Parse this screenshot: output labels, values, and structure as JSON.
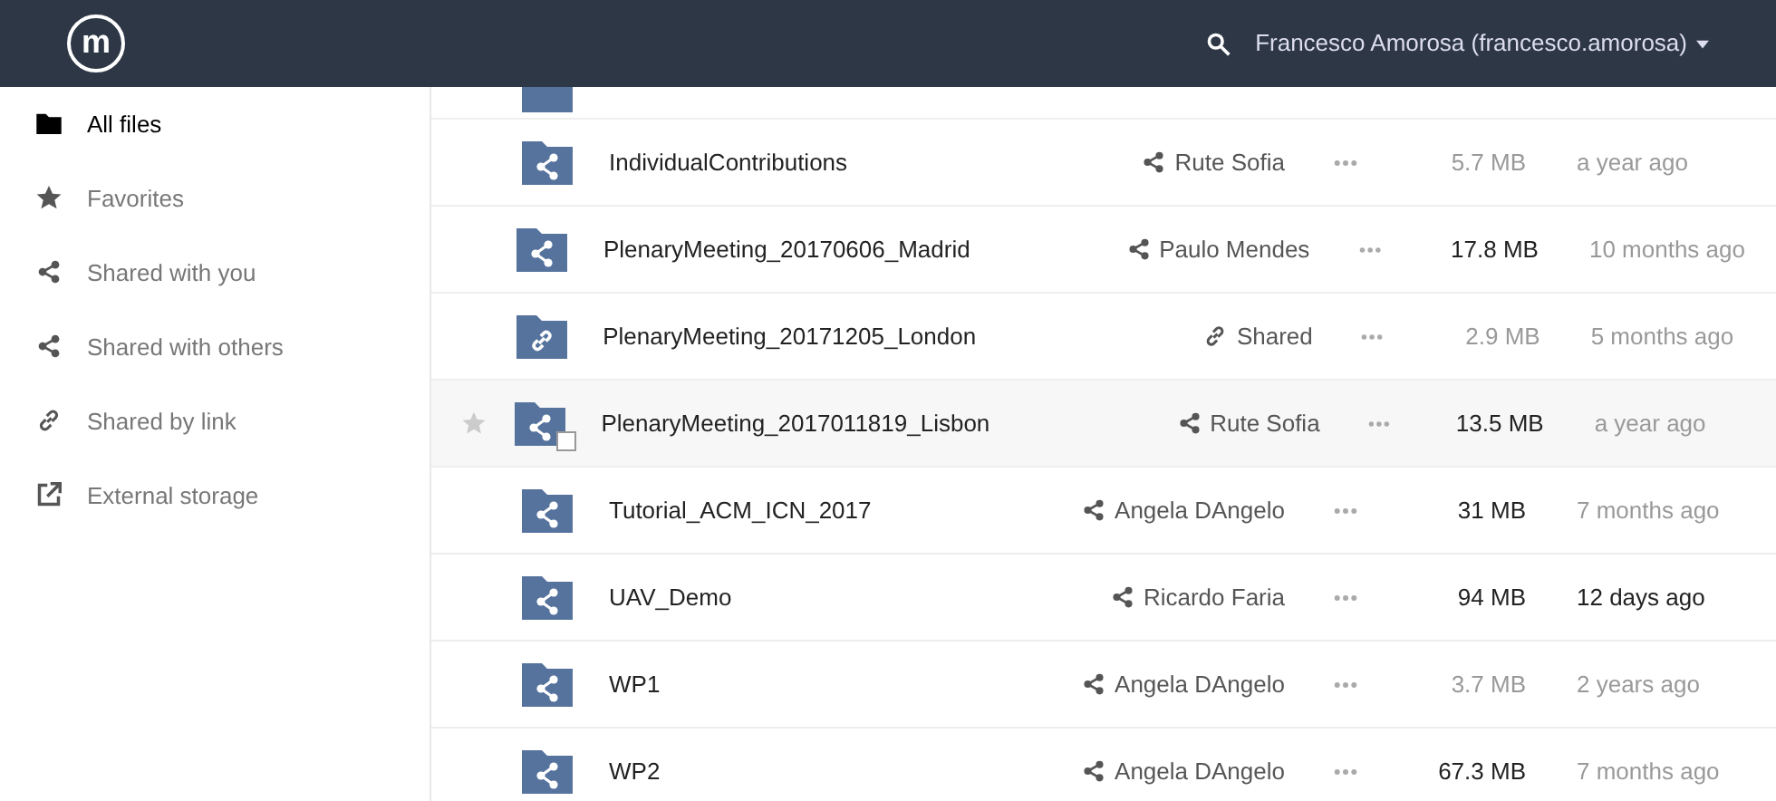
{
  "header": {
    "logo_text": "m",
    "user_name": "Francesco Amorosa (francesco.amorosa)"
  },
  "sidebar": {
    "items": [
      {
        "label": "All files",
        "kind": "folder",
        "selected": true
      },
      {
        "label": "Favorites",
        "kind": "star",
        "selected": false
      },
      {
        "label": "Shared with you",
        "kind": "share",
        "selected": false
      },
      {
        "label": "Shared with others",
        "kind": "share",
        "selected": false
      },
      {
        "label": "Shared by link",
        "kind": "link",
        "selected": false
      },
      {
        "label": "External storage",
        "kind": "external",
        "selected": false
      }
    ]
  },
  "files": [
    {
      "name": "IndividualContributions",
      "kind": "user",
      "share_label": "Rute Sofia",
      "size": "5.7 MB",
      "size_emphasized": false,
      "modified": "a year ago",
      "modified_emphasized": false,
      "hovered": false
    },
    {
      "name": "PlenaryMeeting_20170606_Madrid",
      "kind": "user",
      "share_label": "Paulo Mendes",
      "size": "17.8 MB",
      "size_emphasized": true,
      "modified": "10 months ago",
      "modified_emphasized": false,
      "hovered": false
    },
    {
      "name": "PlenaryMeeting_20171205_London",
      "kind": "link",
      "share_label": "Shared",
      "size": "2.9 MB",
      "size_emphasized": false,
      "modified": "5 months ago",
      "modified_emphasized": false,
      "hovered": false
    },
    {
      "name": "PlenaryMeeting_2017011819_Lisbon",
      "kind": "user",
      "share_label": "Rute Sofia",
      "size": "13.5 MB",
      "size_emphasized": true,
      "modified": "a year ago",
      "modified_emphasized": false,
      "hovered": true
    },
    {
      "name": "Tutorial_ACM_ICN_2017",
      "kind": "user",
      "share_label": "Angela DAngelo",
      "size": "31 MB",
      "size_emphasized": true,
      "modified": "7 months ago",
      "modified_emphasized": false,
      "hovered": false
    },
    {
      "name": "UAV_Demo",
      "kind": "user",
      "share_label": "Ricardo Faria",
      "size": "94 MB",
      "size_emphasized": true,
      "modified": "12 days ago",
      "modified_emphasized": true,
      "hovered": false
    },
    {
      "name": "WP1",
      "kind": "user",
      "share_label": "Angela DAngelo",
      "size": "3.7 MB",
      "size_emphasized": false,
      "modified": "2 years ago",
      "modified_emphasized": false,
      "hovered": false
    },
    {
      "name": "WP2",
      "kind": "user",
      "share_label": "Angela DAngelo",
      "size": "67.3 MB",
      "size_emphasized": true,
      "modified": "7 months ago",
      "modified_emphasized": false,
      "hovered": false
    }
  ]
}
